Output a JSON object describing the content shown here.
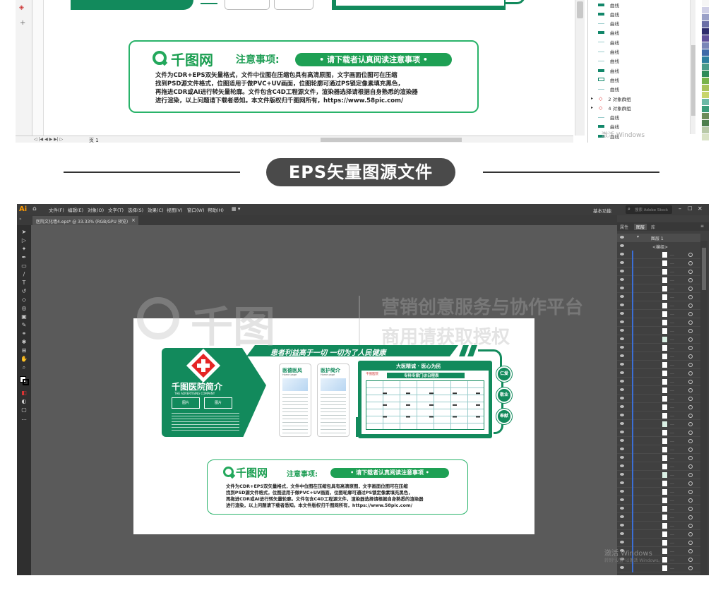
{
  "cdr": {
    "objects": [
      {
        "label": "曲线",
        "kind": "solid"
      },
      {
        "label": "曲线",
        "kind": "solid"
      },
      {
        "label": "曲线",
        "kind": "thin"
      },
      {
        "label": "曲线",
        "kind": "solid"
      },
      {
        "label": "曲线",
        "kind": "thin"
      },
      {
        "label": "曲线",
        "kind": "thin"
      },
      {
        "label": "曲线",
        "kind": "thin"
      },
      {
        "label": "曲线",
        "kind": "solid"
      },
      {
        "label": "曲线",
        "kind": "box"
      },
      {
        "label": "曲线",
        "kind": "thin"
      },
      {
        "label": "2 对象群组",
        "kind": "group"
      },
      {
        "label": "4 对象群组",
        "kind": "group"
      },
      {
        "label": "曲线",
        "kind": "thin"
      },
      {
        "label": "曲线",
        "kind": "solid"
      },
      {
        "label": "曲线",
        "kind": "solid"
      }
    ],
    "page_label": "页 1",
    "activate_windows": "激活 Windows"
  },
  "notice": {
    "brand": "千图网",
    "title": "注意事项:",
    "pill": "• 请下载者认真阅读注意事项 •",
    "lines": [
      "文件为CDR+EPS双矢量格式，文件中位图在压缩包具有高清原图，文字画面位图可在压缩",
      "找到PSD源文件格式，位图适用于做PVC+UV画面，位图轮廓可通过PS锁定像素填充黑色，",
      "再拖进CDR或AI进行转矢量轮廓。文件包含C4D工程源文件，渲染器选择请根据自身熟悉的渲染器",
      "进行渲染，以上问题请下载者悉知。本文件版权归千图网所有，https://www.58pic.com/"
    ]
  },
  "header": {
    "title": "EPS矢量图源文件"
  },
  "ai": {
    "logo": "Ai",
    "menus": [
      "文件(F)",
      "编辑(E)",
      "对象(O)",
      "文字(T)",
      "选择(S)",
      "效果(C)",
      "视图(V)",
      "窗口(W)",
      "帮助(H)"
    ],
    "doc_tab": "医院文化墙4.eps* @ 33.33% (RGB/GPU 预览)",
    "workspace": "基本功能",
    "search_placeholder": "搜索 Adobe Stock",
    "panel_tabs": [
      "属性",
      "图层",
      "库"
    ],
    "layer_name": "图层 1",
    "sublayer_name": "<编组>",
    "activate_windows": "激活 Windows",
    "activate_hint": "转到\"设置\"以激活 Windows。"
  },
  "watermark": {
    "brand": "千图",
    "line1": "营销创意服务与协作平台",
    "line2": "商用请获取授权"
  },
  "board": {
    "slogan": "患者利益高于一切 一切为了人民健康",
    "intro_title": "千图医院简介",
    "intro_sub": "THE ADVERTISING COMPANY",
    "photo_label": "图片",
    "card1_title": "医德医风",
    "card1_sub": "Home page",
    "card2_title": "医护简介",
    "card2_sub": "Home page",
    "banner": "大医精诚 · 医心为民",
    "schedule_title": "专科专家门诊日程表",
    "hospital_name": "千图医院",
    "values": [
      "仁爱",
      "敬业",
      "奉献"
    ]
  },
  "colors": {
    "accent_green": "#128a5c",
    "notice_green": "#1ea054",
    "header_pill": "#4a4a4a"
  }
}
